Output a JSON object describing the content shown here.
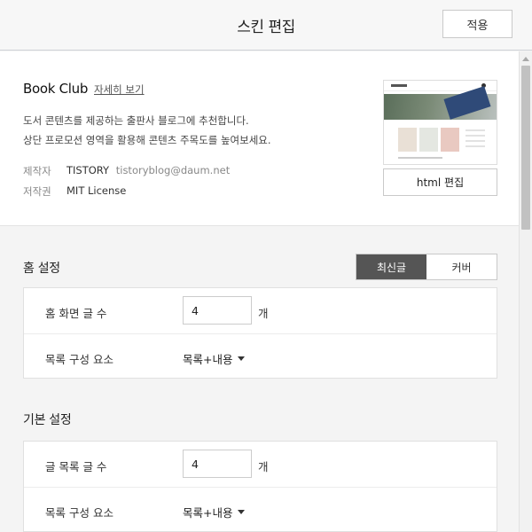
{
  "header": {
    "title": "스킨 편집",
    "apply_label": "적용"
  },
  "skin": {
    "name": "Book Club",
    "detail_link": "자세히 보기",
    "description_lines": [
      "도서 콘텐츠를 제공하는 출판사 블로그에 추천합니다.",
      "상단 프로모션 영역을 활용해 콘텐츠 주목도를 높여보세요."
    ],
    "author_label": "제작자",
    "author_name": "TISTORY",
    "author_email": "tistoryblog@daum.net",
    "license_label": "저작권",
    "license_value": "MIT License",
    "thumbnail_icon": "skin-preview-thumbnail",
    "html_edit_label": "html 편집"
  },
  "home_settings": {
    "title": "홈 설정",
    "toggle": {
      "options": [
        "최신글",
        "커버"
      ],
      "selected": "최신글"
    },
    "post_count_label": "홈 화면 글 수",
    "post_count_value": "4",
    "post_count_unit": "개",
    "list_elements_label": "목록 구성 요소",
    "list_elements_value": "목록+내용"
  },
  "basic_settings": {
    "title": "기본 설정",
    "post_count_label": "글 목록 글 수",
    "post_count_value": "4",
    "post_count_unit": "개",
    "list_elements_label": "목록 구성 요소",
    "list_elements_value": "목록+내용"
  },
  "colors": {
    "toggle_active_bg": "#555555",
    "page_bg": "#f4f4f4",
    "panel_bg": "#ffffff"
  }
}
